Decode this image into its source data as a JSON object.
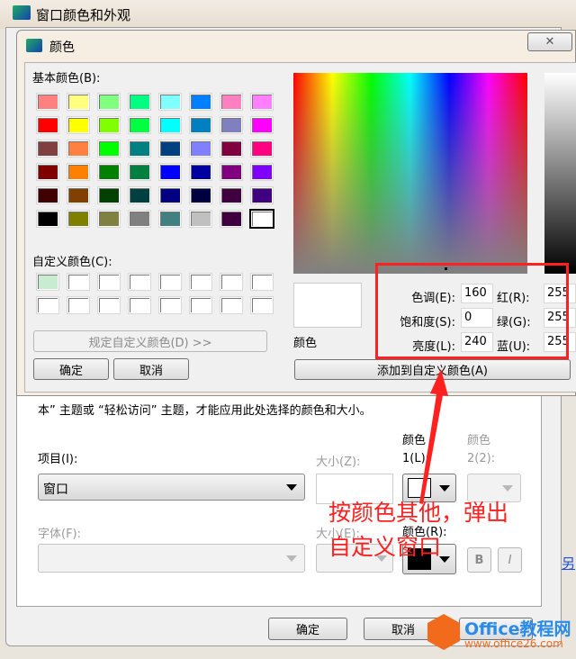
{
  "outer_window": {
    "title": "窗口颜色和外观",
    "hint": "本” 主题或 “轻松访问” 主题，才能应用此处选择的颜色和大小。",
    "item_label": "项目(I):",
    "item_value": "窗口",
    "size_label": "大小(Z):",
    "color1_label_a": "颜色",
    "color1_label_b": "1(L):",
    "color2_label_a": "颜色",
    "color2_label_b": "2(2):",
    "font_label": "字体(F):",
    "font_size_label": "大小(E):",
    "font_color_label": "颜色(R):",
    "bold": "B",
    "italic": "I",
    "ok": "确定",
    "cancel": "取消",
    "link_fragment": "另"
  },
  "color_dialog": {
    "title": "颜色",
    "close": "✕",
    "basic_colors_label": "基本颜色(B):",
    "custom_colors_label": "自定义颜色(C):",
    "define_custom_button": "规定自定义颜色(D) >>",
    "ok": "确定",
    "cancel": "取消",
    "preview_label": "颜色",
    "hue_label": "色调(E):",
    "hue": "160",
    "sat_label": "饱和度(S):",
    "sat": "0",
    "lum_label": "亮度(L):",
    "lum": "240",
    "red_label": "红(R):",
    "red": "255",
    "green_label": "绿(G):",
    "green": "255",
    "blue_label": "蓝(U):",
    "blue": "255",
    "add_custom_button": "添加到自定义颜色(A)",
    "basic_colors": [
      "#ff8080",
      "#ffff80",
      "#80ff80",
      "#00ff80",
      "#80ffff",
      "#0080ff",
      "#ff80c0",
      "#ff80ff",
      "#ff0000",
      "#ffff00",
      "#80ff00",
      "#00ff40",
      "#00ffff",
      "#0080c0",
      "#8080c0",
      "#ff00ff",
      "#804040",
      "#ff8040",
      "#00ff00",
      "#008080",
      "#004080",
      "#8080ff",
      "#800040",
      "#ff0080",
      "#800000",
      "#ff8000",
      "#008000",
      "#008040",
      "#0000ff",
      "#0000a0",
      "#800080",
      "#8000ff",
      "#400000",
      "#804000",
      "#004000",
      "#004040",
      "#000080",
      "#000040",
      "#400040",
      "#400080",
      "#000000",
      "#808000",
      "#808040",
      "#808080",
      "#408080",
      "#c0c0c0",
      "#400040",
      "#ffffff"
    ],
    "custom_colors": [
      "#c8ecd0",
      "#ffffff",
      "#ffffff",
      "#ffffff",
      "#ffffff",
      "#ffffff",
      "#ffffff",
      "#ffffff",
      "#ffffff",
      "#ffffff",
      "#ffffff",
      "#ffffff",
      "#ffffff",
      "#ffffff",
      "#ffffff",
      "#ffffff"
    ]
  },
  "annotation": {
    "line1": "按颜色其他，弹出",
    "line2": "自定义窗口",
    "color": "#ff2020"
  },
  "watermark": {
    "brand": "Office教程网",
    "url": "www.office26.com"
  }
}
